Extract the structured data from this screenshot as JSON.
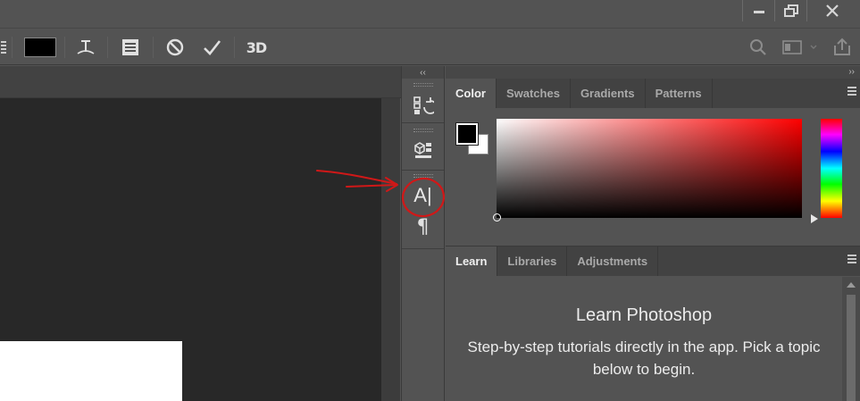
{
  "window": {
    "minimize_icon": "minimize-icon",
    "restore_icon": "restore-icon",
    "close_icon": "close-icon"
  },
  "options_bar": {
    "text_color_swatch": "#000000",
    "warp_text_icon": "warp-text-icon",
    "panels_toggle_icon": "panels-toggle-icon",
    "cancel_icon": "cancel-icon",
    "commit_icon": "checkmark-icon",
    "threed_label": "3D",
    "search_icon": "search-icon",
    "workspace_icon": "workspace-icon",
    "share_icon": "share-icon"
  },
  "dock": {
    "collapse_label": "‹‹",
    "items": [
      {
        "name": "history",
        "icon": "history-icon"
      },
      {
        "name": "3d-panel",
        "icon": "3d-panel-icon"
      },
      {
        "name": "character",
        "icon": "character-icon",
        "glyph": "A|"
      },
      {
        "name": "paragraph",
        "icon": "paragraph-icon",
        "glyph": "¶"
      }
    ]
  },
  "right_panels": {
    "expand_label": "››",
    "color_panel": {
      "tabs": [
        "Color",
        "Swatches",
        "Gradients",
        "Patterns"
      ],
      "active_tab": "Color",
      "foreground": "#000000",
      "background": "#ffffff",
      "hue": "#ff0000"
    },
    "learn_panel": {
      "tabs": [
        "Learn",
        "Libraries",
        "Adjustments"
      ],
      "active_tab": "Learn",
      "title": "Learn Photoshop",
      "description": "Step-by-step tutorials directly in the app. Pick a topic below to begin."
    }
  },
  "annotation": {
    "color": "#d01818"
  }
}
